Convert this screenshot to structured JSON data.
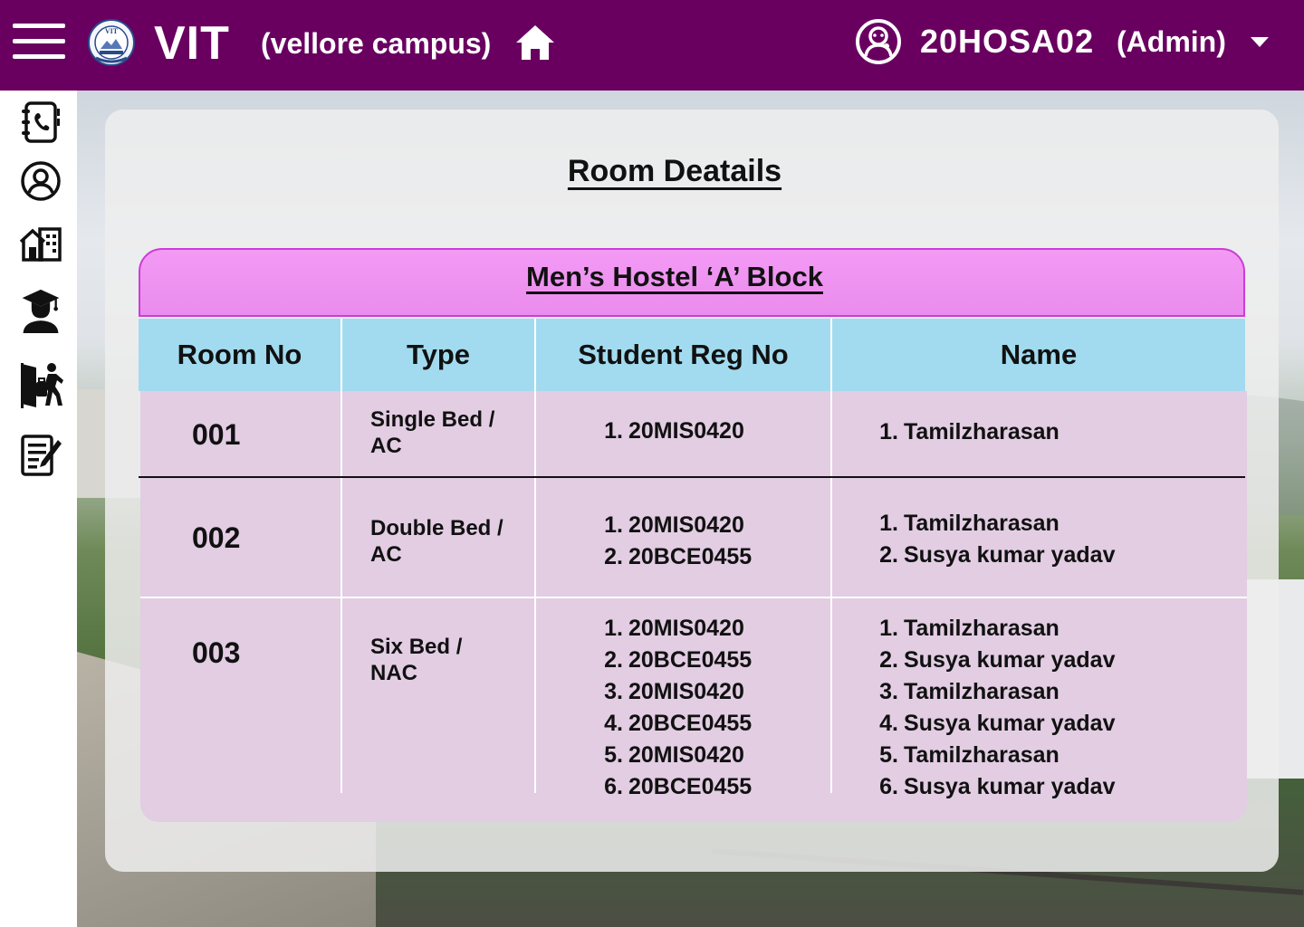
{
  "header": {
    "brand": "VIT",
    "campus": "(vellore campus)",
    "user_id": "20HOSA02",
    "user_role": "(Admin)"
  },
  "icons": {
    "menu": "hamburger-menu-icon",
    "logo": "vit-logo",
    "home": "home-icon",
    "user": "user-face-icon",
    "caret": "chevron-down-icon",
    "sidebar": [
      "contacts-book-icon",
      "profile-icon",
      "buildings-icon",
      "graduate-icon",
      "checkout-icon",
      "edit-notes-icon"
    ]
  },
  "colors": {
    "topbar": "#690060",
    "table_title_bg": "#f39af5",
    "table_title_border": "#cb3dd6",
    "column_header_bg": "#a2dbef",
    "table_body_bg": "#e2cde3"
  },
  "page": {
    "title": "Room Deatails"
  },
  "table": {
    "title": "Men’s Hostel ‘A’ Block",
    "columns": [
      "Room No",
      "Type",
      "Student Reg No",
      "Name"
    ],
    "rows": [
      {
        "room_no": "001",
        "type_line1": "Single Bed /",
        "type_line2": "AC",
        "reg_nos": [
          "20MIS0420"
        ],
        "names": [
          "Tamilzharasan"
        ]
      },
      {
        "room_no": "002",
        "type_line1": "Double Bed /",
        "type_line2": "AC",
        "reg_nos": [
          "20MIS0420",
          "20BCE0455"
        ],
        "names": [
          "Tamilzharasan",
          "Susya kumar yadav"
        ]
      },
      {
        "room_no": "003",
        "type_line1": "Six Bed /",
        "type_line2": "NAC",
        "reg_nos": [
          "20MIS0420",
          "20BCE0455",
          "20MIS0420",
          "20BCE0455",
          "20MIS0420",
          "20BCE0455"
        ],
        "names": [
          "Tamilzharasan",
          "Susya kumar yadav",
          "Tamilzharasan",
          "Susya kumar yadav",
          "Tamilzharasan",
          "Susya kumar yadav"
        ]
      }
    ]
  }
}
